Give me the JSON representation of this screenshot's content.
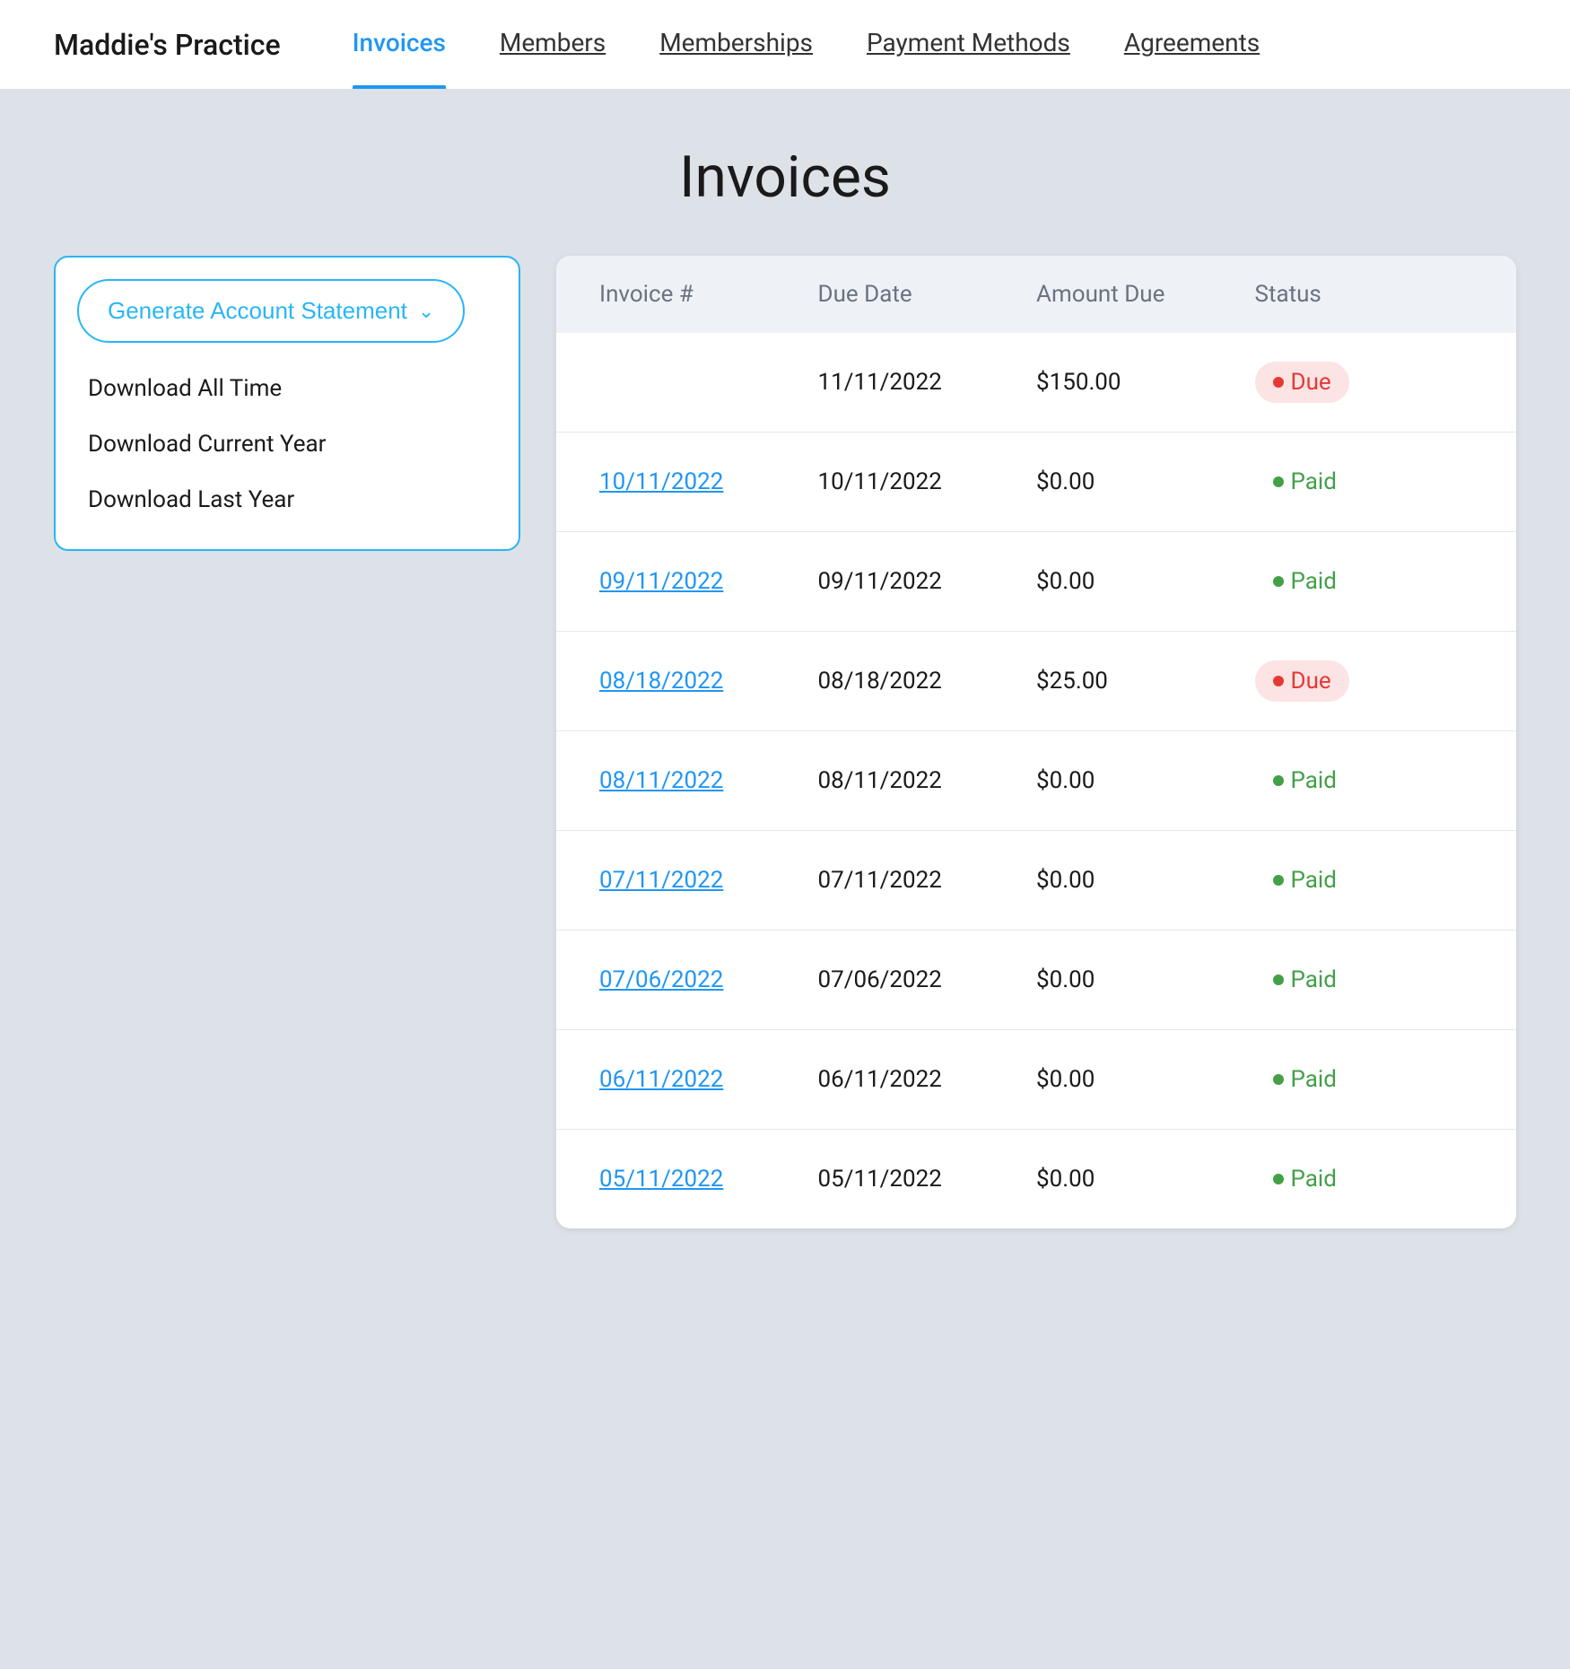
{
  "brand": "Maddie's Practice",
  "nav": {
    "items": [
      {
        "id": "invoices",
        "label": "Invoices",
        "active": true,
        "underlined": false
      },
      {
        "id": "members",
        "label": "Members",
        "active": false,
        "underlined": true
      },
      {
        "id": "memberships",
        "label": "Memberships",
        "active": false,
        "underlined": true
      },
      {
        "id": "payment-methods",
        "label": "Payment Methods",
        "active": false,
        "underlined": true
      },
      {
        "id": "agreements",
        "label": "Agreements",
        "active": false,
        "underlined": true
      }
    ]
  },
  "page": {
    "title": "Invoices"
  },
  "generate_statement": {
    "button_label": "Generate Account Statement",
    "chevron": "∨",
    "menu_items": [
      {
        "id": "all-time",
        "label": "Download All Time"
      },
      {
        "id": "current-year",
        "label": "Download Current Year"
      },
      {
        "id": "last-year",
        "label": "Download Last Year"
      }
    ]
  },
  "table": {
    "headers": [
      "Invoice #",
      "Due Date",
      "Amount Due",
      "Status"
    ],
    "rows": [
      {
        "invoice": "",
        "link": false,
        "due_date": "11/11/2022",
        "amount": "$150.00",
        "status": "Due",
        "status_type": "due"
      },
      {
        "invoice": "10/11/2022",
        "link": true,
        "due_date": "10/11/2022",
        "amount": "$0.00",
        "status": "Paid",
        "status_type": "paid"
      },
      {
        "invoice": "09/11/2022",
        "link": true,
        "due_date": "09/11/2022",
        "amount": "$0.00",
        "status": "Paid",
        "status_type": "paid"
      },
      {
        "invoice": "08/18/2022",
        "link": true,
        "due_date": "08/18/2022",
        "amount": "$25.00",
        "status": "Due",
        "status_type": "due"
      },
      {
        "invoice": "08/11/2022",
        "link": true,
        "due_date": "08/11/2022",
        "amount": "$0.00",
        "status": "Paid",
        "status_type": "paid"
      },
      {
        "invoice": "07/11/2022",
        "link": true,
        "due_date": "07/11/2022",
        "amount": "$0.00",
        "status": "Paid",
        "status_type": "paid"
      },
      {
        "invoice": "07/06/2022",
        "link": true,
        "due_date": "07/06/2022",
        "amount": "$0.00",
        "status": "Paid",
        "status_type": "paid"
      },
      {
        "invoice": "06/11/2022",
        "link": true,
        "due_date": "06/11/2022",
        "amount": "$0.00",
        "status": "Paid",
        "status_type": "paid"
      },
      {
        "invoice": "05/11/2022",
        "link": true,
        "due_date": "05/11/2022",
        "amount": "$0.00",
        "status": "Paid",
        "status_type": "paid"
      }
    ]
  }
}
